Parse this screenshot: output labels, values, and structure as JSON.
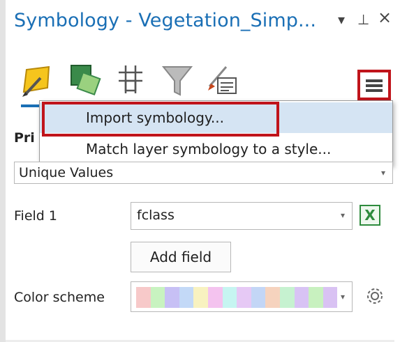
{
  "pane": {
    "title": "Symbology - Vegetation_Simp...",
    "controls": {
      "dropdown": "▾",
      "pin": "⊥",
      "close": "×"
    }
  },
  "toolbar": {
    "tabs": [
      {
        "icon": "primary-symbology-icon"
      },
      {
        "icon": "vary-symbology-icon"
      },
      {
        "icon": "symbol-layer-drawing-icon"
      },
      {
        "icon": "filter-funnel-icon"
      },
      {
        "icon": "label-brush-icon"
      }
    ],
    "menu_icon": "hamburger-menu-icon"
  },
  "behind_label": "Pri",
  "menu": {
    "items": [
      {
        "label": "Import symbology...",
        "highlighted": true
      },
      {
        "label": "Match layer symbology to a style..."
      }
    ]
  },
  "primary_symbology": {
    "value": "Unique Values",
    "arrow": "▾"
  },
  "field1": {
    "label": "Field 1",
    "value": "fclass",
    "arrow": "▾",
    "icon": "excel-sql-icon"
  },
  "add_field": {
    "label": "Add field"
  },
  "color_scheme": {
    "label": "Color scheme",
    "arrow": "▾",
    "icon": "gear-icon",
    "swatches": [
      "#f7c9c9",
      "#c8f3c0",
      "#c7c0f5",
      "#c3d9f7",
      "#f8f2c0",
      "#f4c3ef",
      "#c6f5f1",
      "#e6c9f5",
      "#c3d6f6",
      "#f6d3be",
      "#c6f2d0",
      "#d8c3f4",
      "#c8f1bf",
      "#d9c2f3"
    ]
  },
  "colors": {
    "accent": "#1a6fb5",
    "highlight": "#d5e4f3",
    "callout": "#c0141b"
  }
}
